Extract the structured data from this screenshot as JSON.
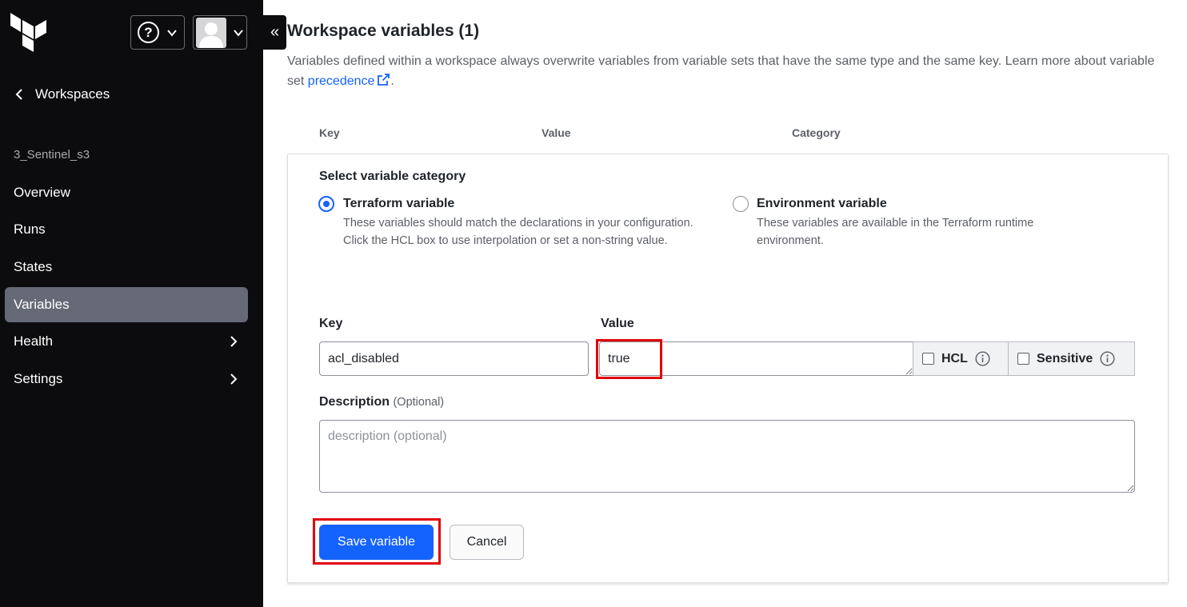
{
  "sidebar": {
    "logo_icon": "terraform-logo-icon",
    "help_icon": "help-circle-icon",
    "help_glyph": "?",
    "user_icon": "user-avatar-icon",
    "collapse_glyph": "«",
    "back_label": "Workspaces",
    "workspace_name": "3_Sentinel_s3",
    "nav_items": [
      {
        "label": "Overview",
        "active": false,
        "has_submenu": false
      },
      {
        "label": "Runs",
        "active": false,
        "has_submenu": false
      },
      {
        "label": "States",
        "active": false,
        "has_submenu": false
      },
      {
        "label": "Variables",
        "active": true,
        "has_submenu": false
      },
      {
        "label": "Health",
        "active": false,
        "has_submenu": true
      },
      {
        "label": "Settings",
        "active": false,
        "has_submenu": true
      }
    ]
  },
  "main": {
    "title": "Workspace variables (1)",
    "description_prefix": "Variables defined within a workspace always overwrite variables from variable sets that have the same type and the same key. Learn more about variable set ",
    "description_link": "precedence",
    "description_suffix": ".",
    "table_headers": [
      "Key",
      "Value",
      "Category"
    ]
  },
  "form": {
    "select_category_label": "Select variable category",
    "categories": [
      {
        "title": "Terraform variable",
        "help": "These variables should match the declarations in your configuration. Click the HCL box to use interpolation or set a non-string value.",
        "selected": true
      },
      {
        "title": "Environment variable",
        "help": "These variables are available in the Terraform runtime environment.",
        "selected": false
      }
    ],
    "key_label": "Key",
    "key_value": "acl_disabled",
    "value_label": "Value",
    "value_value": "true",
    "hcl_label": "HCL",
    "hcl_checked": false,
    "sensitive_label": "Sensitive",
    "sensitive_checked": false,
    "description_label": "Description",
    "description_optional": "(Optional)",
    "description_placeholder": "description (optional)",
    "save_label": "Save variable",
    "cancel_label": "Cancel"
  },
  "colors": {
    "sidebar_bg": "#0c0c0e",
    "active_nav": "#656a76",
    "primary": "#1563ff",
    "highlight": "#e0000b"
  }
}
